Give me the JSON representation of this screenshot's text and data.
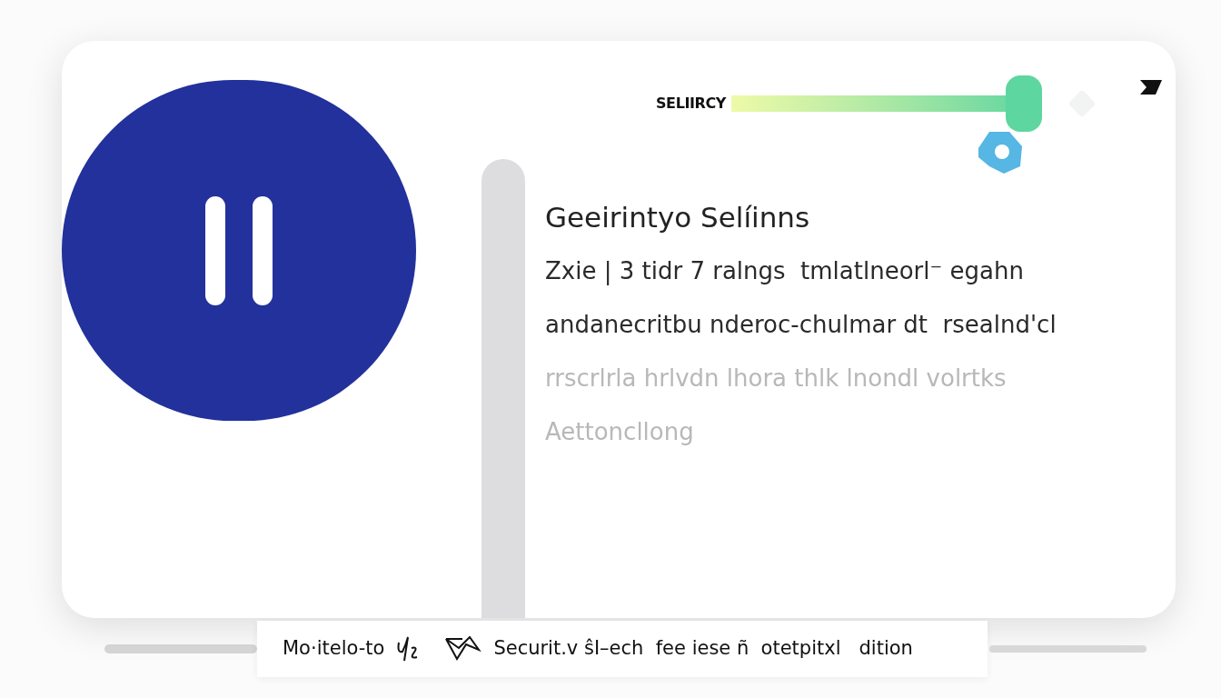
{
  "slider": {
    "label": "SELIIRCY",
    "level": 0.93
  },
  "article": {
    "title": "Geeirintyo Selíinns",
    "lines": [
      {
        "text": "Zxie | 3 tidr 7 ralngs  tmlatlneorl⁻ egahn",
        "faded": false
      },
      {
        "text": "andanecritbu nderoc-chulmar dt  rsealnd'cl",
        "faded": false
      },
      {
        "text": "rrscrlrla hrlvdn lhora thlk lnondl volrtks",
        "faded": true
      },
      {
        "text": "Aettoncllong",
        "faded": true
      }
    ]
  },
  "footer": {
    "left_text": "Mo·itelo-to",
    "right_text": "Securit.v ŝI–ech  fee iese ñ  otetpitxl   dition"
  }
}
